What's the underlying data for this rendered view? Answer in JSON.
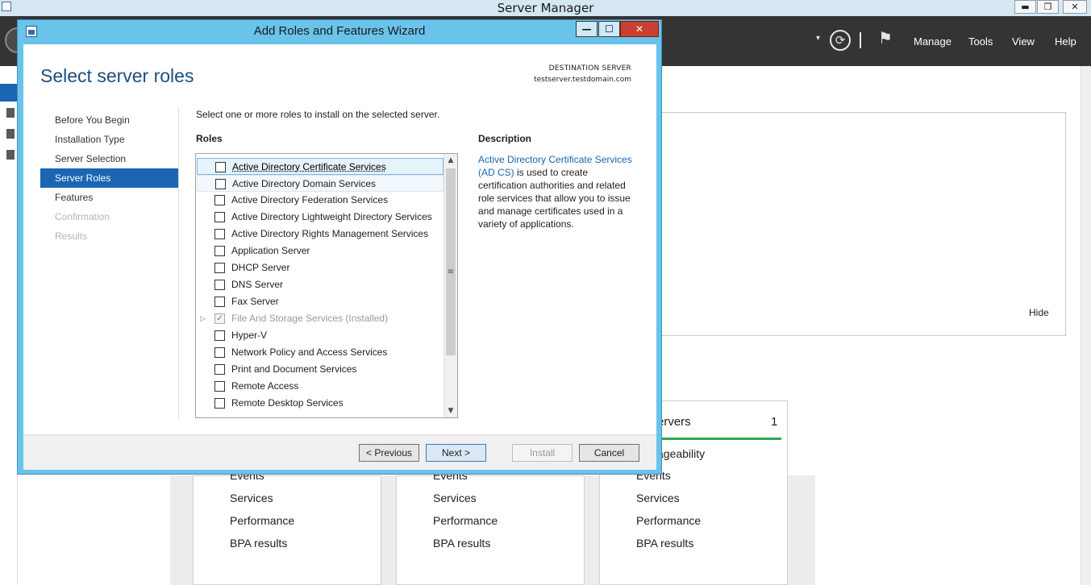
{
  "server_manager": {
    "title": "Server Manager",
    "window_controls": {
      "minimize": "▬",
      "restore": "❐",
      "close": "✕"
    },
    "header_menu": [
      "Manage",
      "Tools",
      "View",
      "Help"
    ],
    "welcome_hide": "Hide",
    "tiles": [
      {
        "rows": [
          "Events",
          "Services",
          "Performance",
          "BPA results"
        ]
      },
      {
        "rows": [
          "Events",
          "Services",
          "Performance",
          "BPA results"
        ]
      },
      {
        "title": "ervers",
        "count": "1",
        "manageability": "ageability",
        "rows": [
          "Events",
          "Services",
          "Performance",
          "BPA results"
        ]
      }
    ]
  },
  "wizard": {
    "title": "Add Roles and Features Wizard",
    "controls": {
      "minimize": "—",
      "maximize": "☐",
      "close": "✕"
    },
    "heading": "Select server roles",
    "destination_label": "DESTINATION SERVER",
    "destination_value": "testserver.testdomain.com",
    "steps": [
      {
        "label": "Before You Begin",
        "state": "normal"
      },
      {
        "label": "Installation Type",
        "state": "normal"
      },
      {
        "label": "Server Selection",
        "state": "normal"
      },
      {
        "label": "Server Roles",
        "state": "active"
      },
      {
        "label": "Features",
        "state": "normal"
      },
      {
        "label": "Confirmation",
        "state": "disabled"
      },
      {
        "label": "Results",
        "state": "disabled"
      }
    ],
    "instruction": "Select one or more roles to install on the selected server.",
    "roles_heading": "Roles",
    "roles": [
      "Active Directory Certificate Services",
      "Active Directory Domain Services",
      "Active Directory Federation Services",
      "Active Directory Lightweight Directory Services",
      "Active Directory Rights Management Services",
      "Application Server",
      "DHCP Server",
      "DNS Server",
      "Fax Server",
      "File And Storage Services (Installed)",
      "Hyper-V",
      "Network Policy and Access Services",
      "Print and Document Services",
      "Remote Access",
      "Remote Desktop Services"
    ],
    "check_mark": "✓",
    "expander": "▷",
    "description_heading": "Description",
    "description_link": "Active Directory Certificate Services (AD CS)",
    "description_text": " is used to create certification authorities and related role services that allow you to issue and manage certificates used in a variety of applications.",
    "buttons": {
      "previous": "< Previous",
      "next": "Next >",
      "install": "Install",
      "cancel": "Cancel"
    },
    "scroll": {
      "up": "▲",
      "down": "▼",
      "grip": "≡"
    }
  }
}
